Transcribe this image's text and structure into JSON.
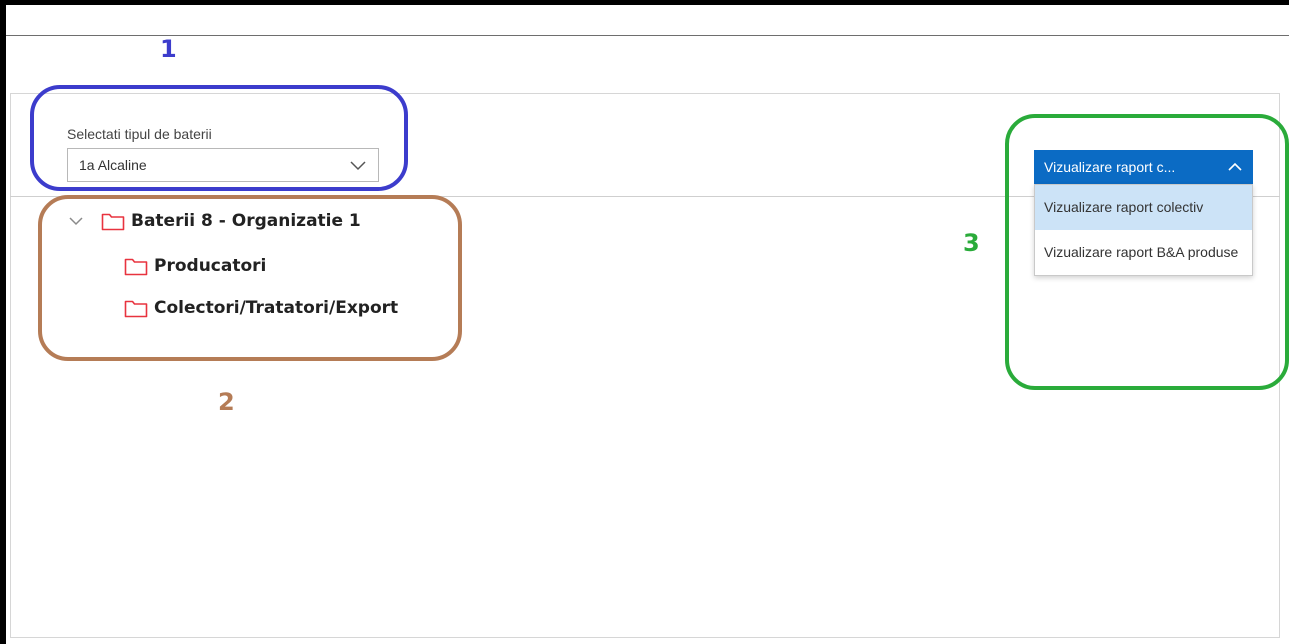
{
  "annotations": {
    "label_1": "1",
    "label_2": "2",
    "label_3": "3",
    "color_1": "#3c3ccc",
    "color_2": "#b57c56",
    "color_3": "#2aab3a"
  },
  "battery_select": {
    "label": "Selectati tipul de baterii",
    "value": "1a Alcaline",
    "icon": "chevron-down-icon"
  },
  "tree": {
    "root": {
      "label": "Baterii 8 - Organizatie 1",
      "expanded": true,
      "toggle_icon": "chevron-down-icon",
      "icon": "folder-icon"
    },
    "children": [
      {
        "label": "Producatori",
        "icon": "folder-icon"
      },
      {
        "label": "Colectori/Tratatori/Export",
        "icon": "folder-icon"
      }
    ],
    "folder_color": "#e8333f"
  },
  "report_dropdown": {
    "button_label": "Vizualizare raport c...",
    "icon": "chevron-up-icon",
    "accent_color": "#0b6bc4",
    "options": [
      {
        "label": "Vizualizare raport colectiv",
        "selected": true
      },
      {
        "label": "Vizualizare raport B&A produse",
        "selected": false
      }
    ]
  }
}
